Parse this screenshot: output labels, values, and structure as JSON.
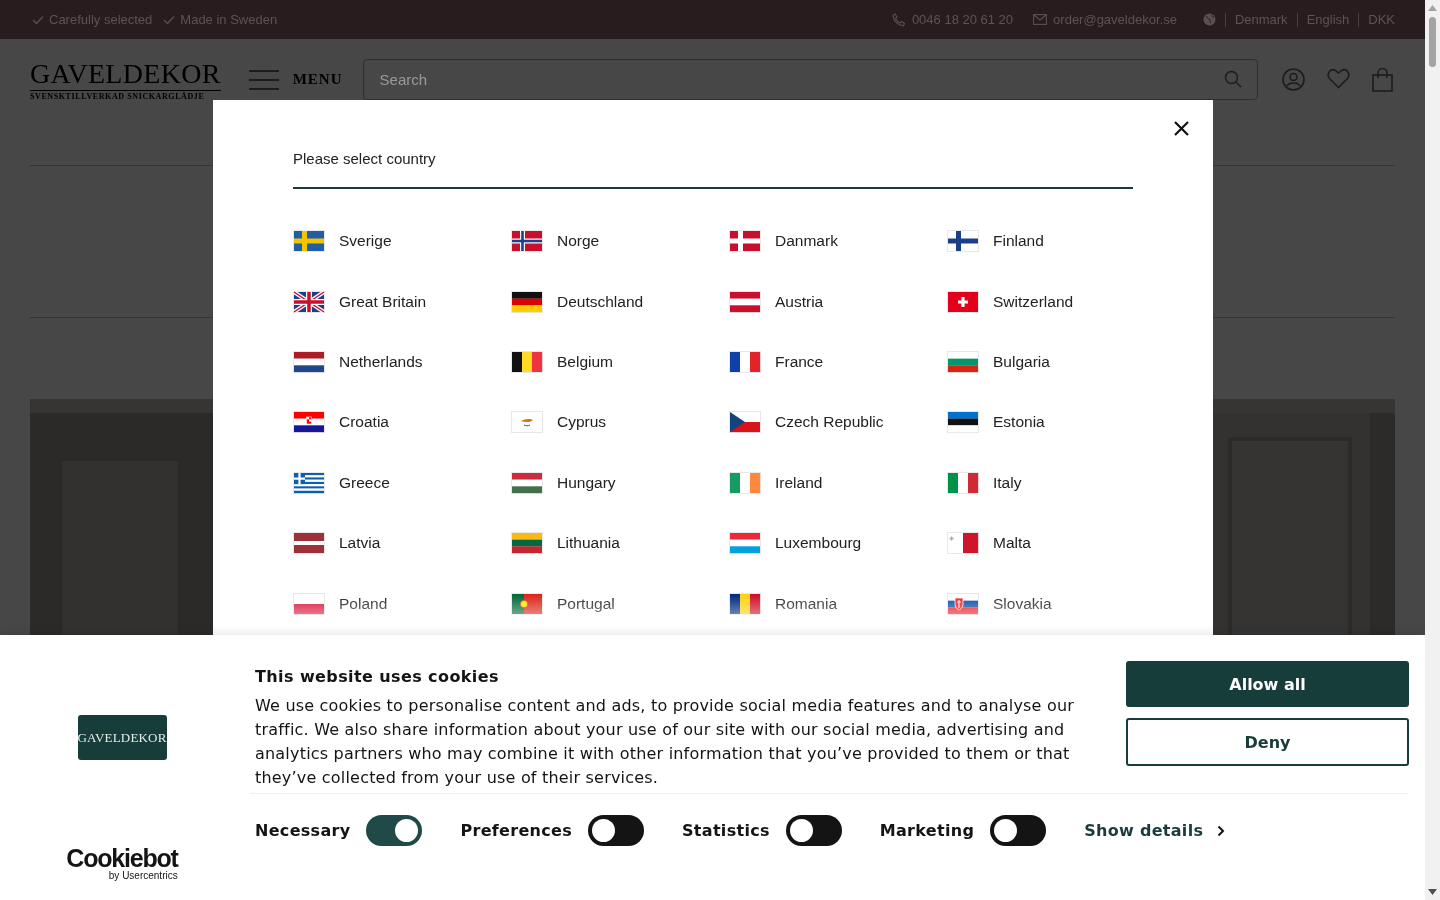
{
  "topbar": {
    "usps": [
      {
        "label": "Carefully selected"
      },
      {
        "label": "Made in Sweden"
      }
    ],
    "phone": "0046 18 20 61 20",
    "email": "order@gaveldekor.se",
    "country": "Denmark",
    "language": "English",
    "currency": "DKK"
  },
  "header": {
    "logo": "GAVELDEKOR",
    "tagline": "SVENSKTILLVERKAD SNICKARGLÄDJE",
    "menu": "MENU",
    "search": {
      "placeholder": "Search"
    }
  },
  "country_dialog": {
    "title": "Please select country",
    "countries": [
      {
        "name": "Sverige"
      },
      {
        "name": "Norge"
      },
      {
        "name": "Danmark"
      },
      {
        "name": "Finland"
      },
      {
        "name": "Great Britain"
      },
      {
        "name": "Deutschland"
      },
      {
        "name": "Austria"
      },
      {
        "name": "Switzerland"
      },
      {
        "name": "Netherlands"
      },
      {
        "name": "Belgium"
      },
      {
        "name": "France"
      },
      {
        "name": "Bulgaria"
      },
      {
        "name": "Croatia"
      },
      {
        "name": "Cyprus"
      },
      {
        "name": "Czech Republic"
      },
      {
        "name": "Estonia"
      },
      {
        "name": "Greece"
      },
      {
        "name": "Hungary"
      },
      {
        "name": "Ireland"
      },
      {
        "name": "Italy"
      },
      {
        "name": "Latvia"
      },
      {
        "name": "Lithuania"
      },
      {
        "name": "Luxembourg"
      },
      {
        "name": "Malta"
      },
      {
        "name": "Poland"
      },
      {
        "name": "Portugal"
      },
      {
        "name": "Romania"
      },
      {
        "name": "Slovakia"
      }
    ]
  },
  "cookie_banner": {
    "logo": "GAVELDEKOR",
    "title": "This website uses cookies",
    "body": "We use cookies to personalise content and ads, to provide social media features and to analyse our traffic. We also share information about your use of our site with our social media, advertising and analytics partners who may combine it with other information that you’ve provided to them or that they’ve collected from your use of their services.",
    "buttons": [
      {
        "label": "Allow all",
        "kind": "primary"
      },
      {
        "label": "Deny",
        "kind": "secondary"
      }
    ],
    "consents": [
      {
        "label": "Necessary",
        "on": true
      },
      {
        "label": "Preferences",
        "on": false
      },
      {
        "label": "Statistics",
        "on": false
      },
      {
        "label": "Marketing",
        "on": false
      }
    ],
    "details_link": "Show details",
    "vendor": {
      "name": "Cookiebot",
      "byline": "by Usercentrics"
    }
  }
}
